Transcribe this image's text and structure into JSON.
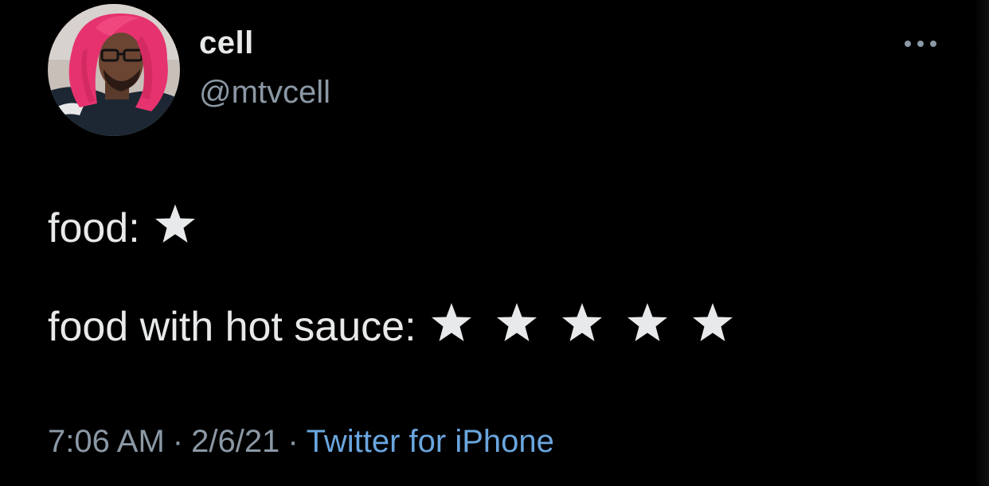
{
  "author": {
    "display_name": "cell",
    "handle": "@mtvcell"
  },
  "more_icon": "more-horizontal-icon",
  "tweet": {
    "line_1": {
      "text": "food:",
      "rating": {
        "stars": 1,
        "icon": "star-icon"
      }
    },
    "line_2": {
      "text": "food with hot sauce:",
      "rating": {
        "stars": 5,
        "icon": "star-icon"
      }
    }
  },
  "meta": {
    "time": "7:06 AM",
    "separator": "·",
    "date": "2/6/21",
    "source": "Twitter for iPhone"
  },
  "colors": {
    "background": "#000000",
    "primary_text": "#e7e9ea",
    "secondary_text": "#8b98a5",
    "link": "#6aa6df",
    "avatar_wig": "#e6336f"
  }
}
